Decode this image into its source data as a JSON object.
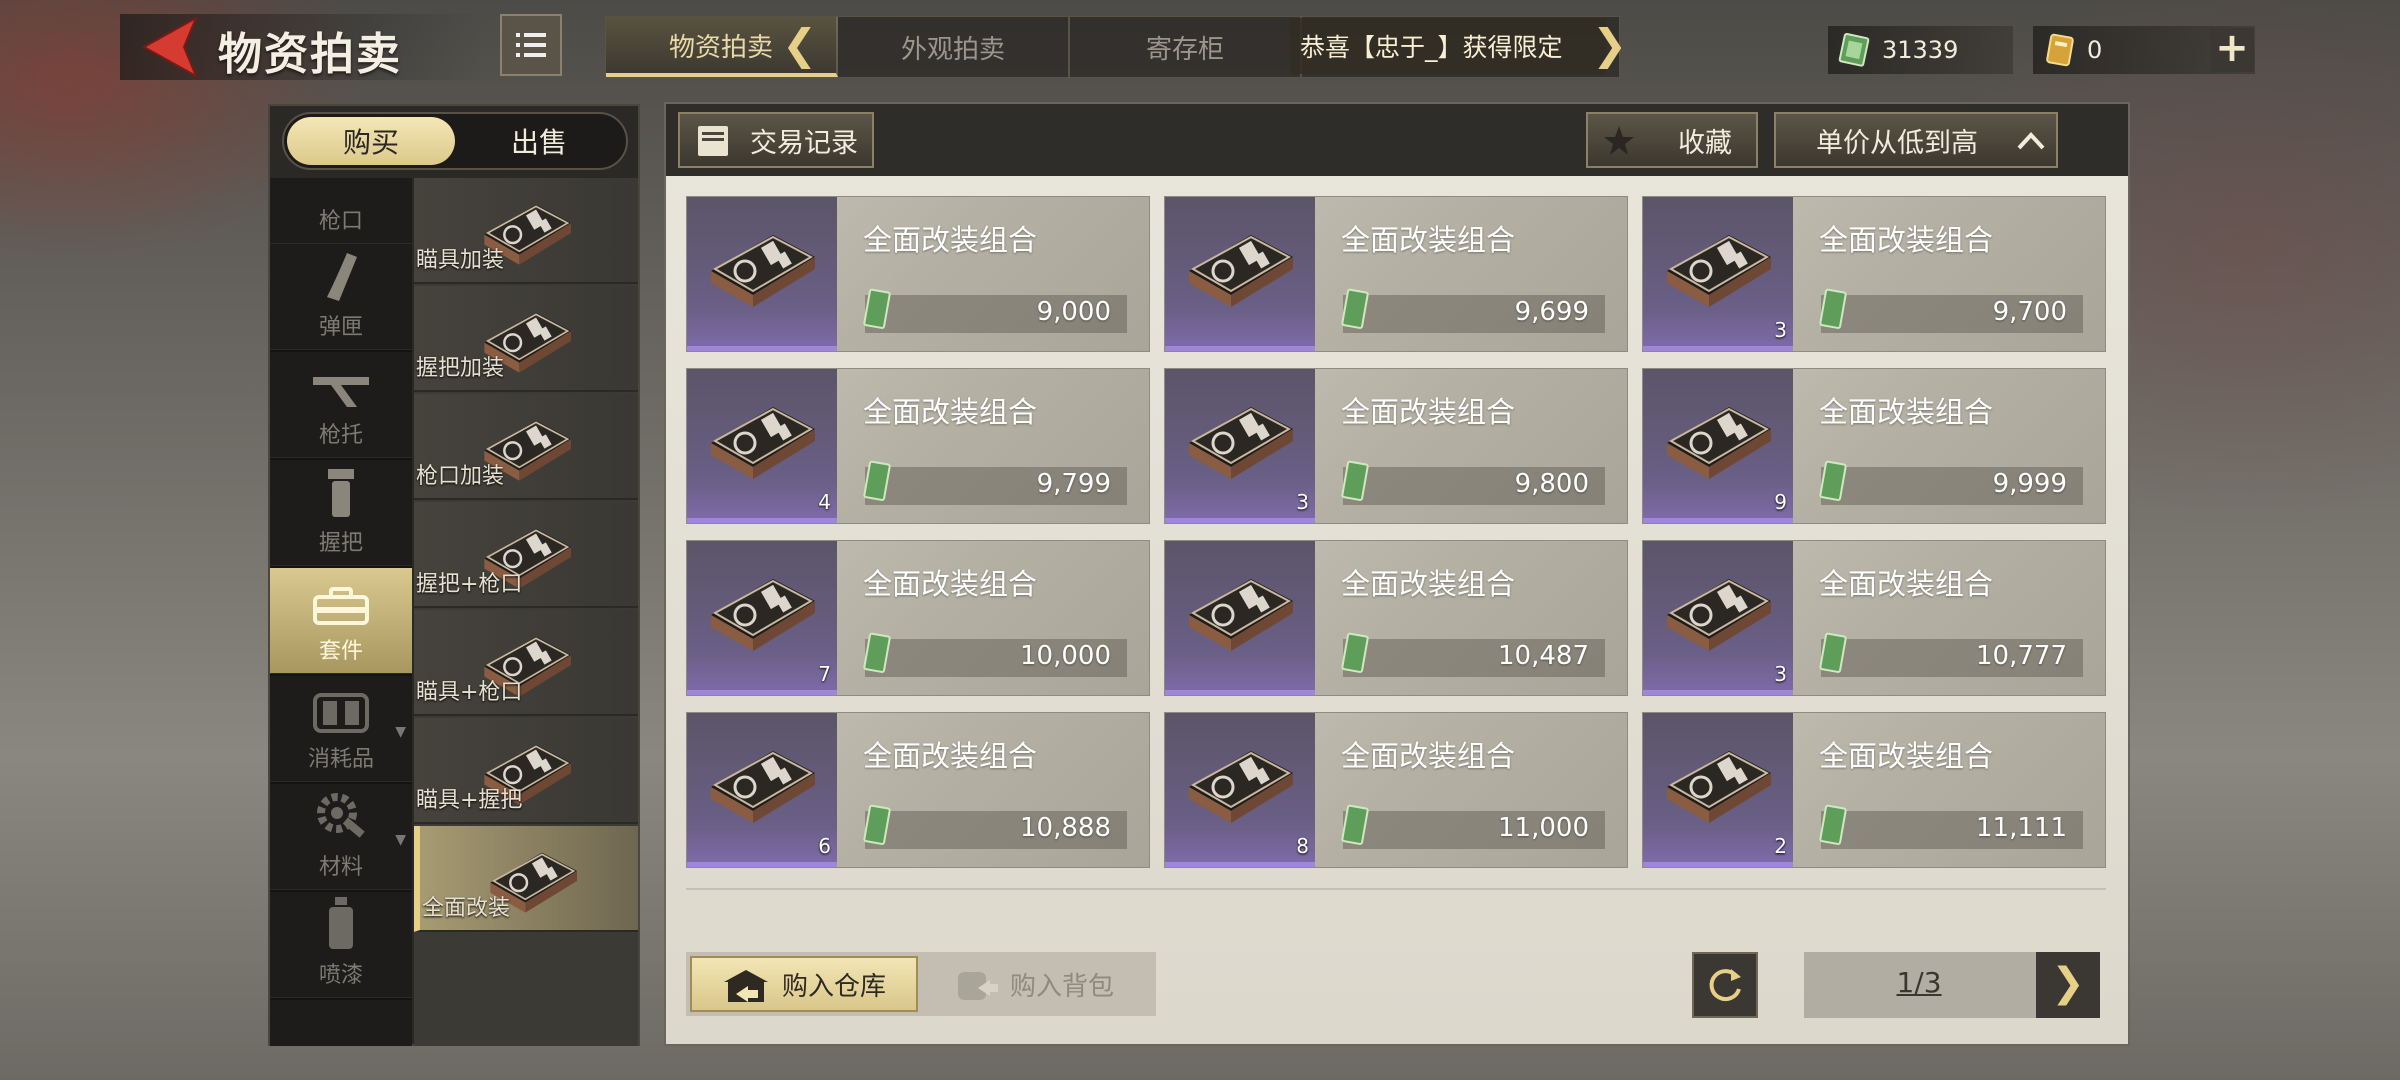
{
  "header": {
    "title": "物资拍卖",
    "tabs": [
      {
        "label": "物资拍卖",
        "active": true
      },
      {
        "label": "外观拍卖",
        "active": false
      },
      {
        "label": "寄存柜",
        "active": false
      }
    ],
    "ticker": "恭喜【忠于_】获得限定 ",
    "cash": "31339",
    "tickets": "0",
    "plus_label": "+"
  },
  "left": {
    "buy_label": "购买",
    "sell_label": "出售",
    "categories": [
      {
        "label": "枪口",
        "icon": "muzzle-icon"
      },
      {
        "label": "弹匣",
        "icon": "magazine-icon"
      },
      {
        "label": "枪托",
        "icon": "stock-icon"
      },
      {
        "label": "握把",
        "icon": "grip-icon"
      },
      {
        "label": "套件",
        "icon": "kit-icon",
        "active": true
      },
      {
        "label": "消耗品",
        "icon": "consumable-icon"
      },
      {
        "label": "材料",
        "icon": "material-icon"
      },
      {
        "label": "喷漆",
        "icon": "paint-icon"
      }
    ],
    "subcategories": [
      {
        "label": "瞄具加装"
      },
      {
        "label": "握把加装"
      },
      {
        "label": "枪口加装"
      },
      {
        "label": "握把+枪口"
      },
      {
        "label": "瞄具+枪口"
      },
      {
        "label": "瞄具+握把"
      },
      {
        "label": "全面改装",
        "active": true
      }
    ]
  },
  "toolbar": {
    "history_label": "交易记录",
    "favorite_label": "收藏",
    "sort_label": "单价从低到高"
  },
  "items": [
    {
      "name": "全面改装组合",
      "price": "9,000",
      "qty": ""
    },
    {
      "name": "全面改装组合",
      "price": "9,699",
      "qty": ""
    },
    {
      "name": "全面改装组合",
      "price": "9,700",
      "qty": "3"
    },
    {
      "name": "全面改装组合",
      "price": "9,799",
      "qty": "4"
    },
    {
      "name": "全面改装组合",
      "price": "9,800",
      "qty": "3"
    },
    {
      "name": "全面改装组合",
      "price": "9,999",
      "qty": "9"
    },
    {
      "name": "全面改装组合",
      "price": "10,000",
      "qty": "7"
    },
    {
      "name": "全面改装组合",
      "price": "10,487",
      "qty": ""
    },
    {
      "name": "全面改装组合",
      "price": "10,777",
      "qty": "3"
    },
    {
      "name": "全面改装组合",
      "price": "10,888",
      "qty": "6"
    },
    {
      "name": "全面改装组合",
      "price": "11,000",
      "qty": "8"
    },
    {
      "name": "全面改装组合",
      "price": "11,111",
      "qty": "2"
    }
  ],
  "footer": {
    "warehouse_label": "购入仓库",
    "backpack_label": "购入背包",
    "page": "1/3"
  },
  "colors": {
    "accent_gold": "#e6cf86",
    "rarity_purple": "#9f86d8"
  }
}
